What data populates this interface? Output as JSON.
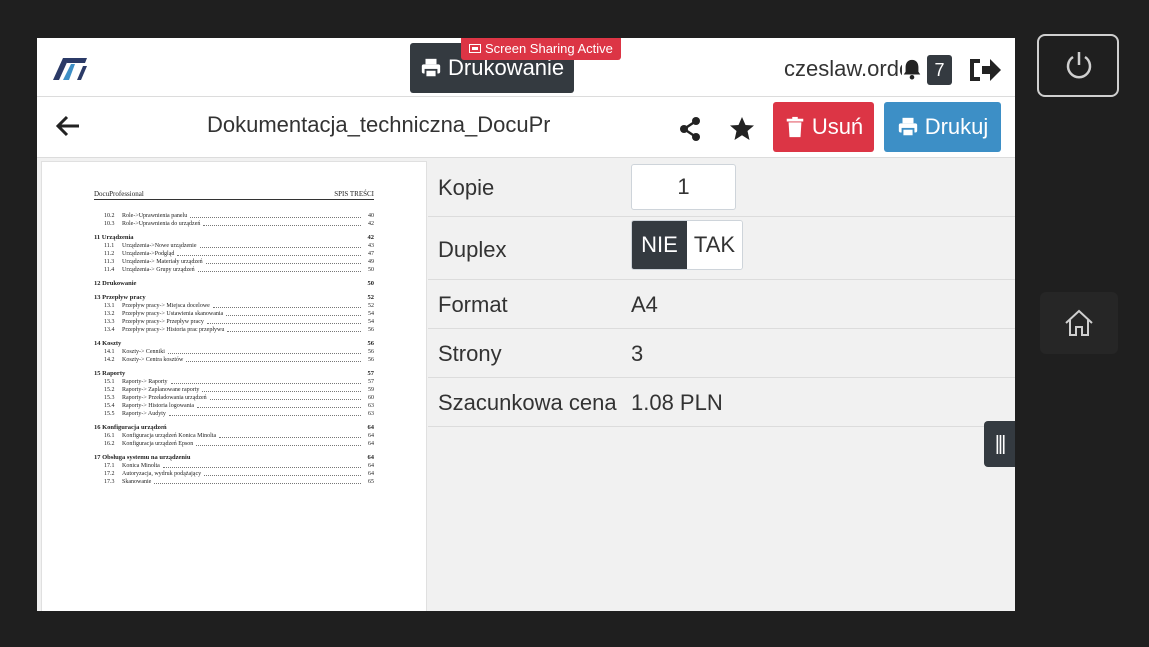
{
  "header": {
    "app_title": "Drukowanie",
    "sharing_badge": "Screen Sharing Active",
    "username": "czeslaw.ordon",
    "notification_count": "7"
  },
  "document": {
    "title": "Dokumentacja_techniczna_DocuProfessional.pdf",
    "delete_label": "Usuń",
    "print_label": "Drukuj"
  },
  "preview": {
    "header_left": "DocuProfessional",
    "header_right": "SPIS TREŚCI",
    "sections": [
      {
        "title": "",
        "page": "",
        "items": [
          {
            "n": "10.2",
            "t": "Role->Uprawnienia panelu",
            "p": "40"
          },
          {
            "n": "10.3",
            "t": "Role->Uprawnienia do urządzeń",
            "p": "42"
          }
        ]
      },
      {
        "title": "11 Urządzenia",
        "page": "42",
        "items": [
          {
            "n": "11.1",
            "t": "Urządzenia->Nowe urządzenie",
            "p": "43"
          },
          {
            "n": "11.2",
            "t": "Urządzenia->Podgląd",
            "p": "47"
          },
          {
            "n": "11.3",
            "t": "Urządzenia-> Materiały urządzeń",
            "p": "49"
          },
          {
            "n": "11.4",
            "t": "Urządzenia-> Grupy urządzeń",
            "p": "50"
          }
        ]
      },
      {
        "title": "12 Drukowanie",
        "page": "50",
        "items": []
      },
      {
        "title": "13 Przepływ pracy",
        "page": "52",
        "items": [
          {
            "n": "13.1",
            "t": "Przepływ pracy-> Miejsca docelowe",
            "p": "52"
          },
          {
            "n": "13.2",
            "t": "Przepływ pracy-> Ustawienia skanowania",
            "p": "54"
          },
          {
            "n": "13.3",
            "t": "Przepływ pracy-> Przepływ pracy",
            "p": "54"
          },
          {
            "n": "13.4",
            "t": "Przepływ pracy-> Historia prac przepływu",
            "p": "56"
          }
        ]
      },
      {
        "title": "14 Koszty",
        "page": "56",
        "items": [
          {
            "n": "14.1",
            "t": "Koszty-> Cenniki",
            "p": "56"
          },
          {
            "n": "14.2",
            "t": "Koszty-> Centra kosztów",
            "p": "56"
          }
        ]
      },
      {
        "title": "15 Raporty",
        "page": "57",
        "items": [
          {
            "n": "15.1",
            "t": "Raporty-> Raporty",
            "p": "57"
          },
          {
            "n": "15.2",
            "t": "Raporty-> Zaplanowane raporty",
            "p": "59"
          },
          {
            "n": "15.3",
            "t": "Raporty-> Przeładowania urządzeń",
            "p": "60"
          },
          {
            "n": "15.4",
            "t": "Raporty-> Historia logowania",
            "p": "63"
          },
          {
            "n": "15.5",
            "t": "Raporty-> Audyty",
            "p": "63"
          }
        ]
      },
      {
        "title": "16 Konfiguracja urządzeń",
        "page": "64",
        "items": [
          {
            "n": "16.1",
            "t": "Konfiguracja urządzeń Konica Minolta",
            "p": "64"
          },
          {
            "n": "16.2",
            "t": "Konfiguracja urządzeń Epson",
            "p": "64"
          }
        ]
      },
      {
        "title": "17 Obsługa systemu na urządzeniu",
        "page": "64",
        "items": [
          {
            "n": "17.1",
            "t": "Konica Minolta",
            "p": "64"
          },
          {
            "n": "17.2",
            "t": "Autoryzacja, wydruk podążający",
            "p": "64"
          },
          {
            "n": "17.3",
            "t": "Skanowanie",
            "p": "65"
          }
        ]
      }
    ]
  },
  "settings": {
    "copies_label": "Kopie",
    "copies_value": "1",
    "duplex_label": "Duplex",
    "duplex_no": "NIE",
    "duplex_yes": "TAK",
    "duplex_selected": "NIE",
    "format_label": "Format",
    "format_value": "A4",
    "pages_label": "Strony",
    "pages_value": "3",
    "price_label": "Szacunkowa cena",
    "price_value": "1.08 PLN"
  },
  "colors": {
    "dark": "#343a40",
    "danger": "#dc3545",
    "primary": "#3d8fc6"
  },
  "icons": [
    "app-logo-icon",
    "printer-icon",
    "screen-share-icon",
    "bell-icon",
    "logout-icon",
    "arrow-left-icon",
    "share-icon",
    "star-icon",
    "trash-icon",
    "drag-handle-icon",
    "power-icon",
    "home-icon"
  ]
}
